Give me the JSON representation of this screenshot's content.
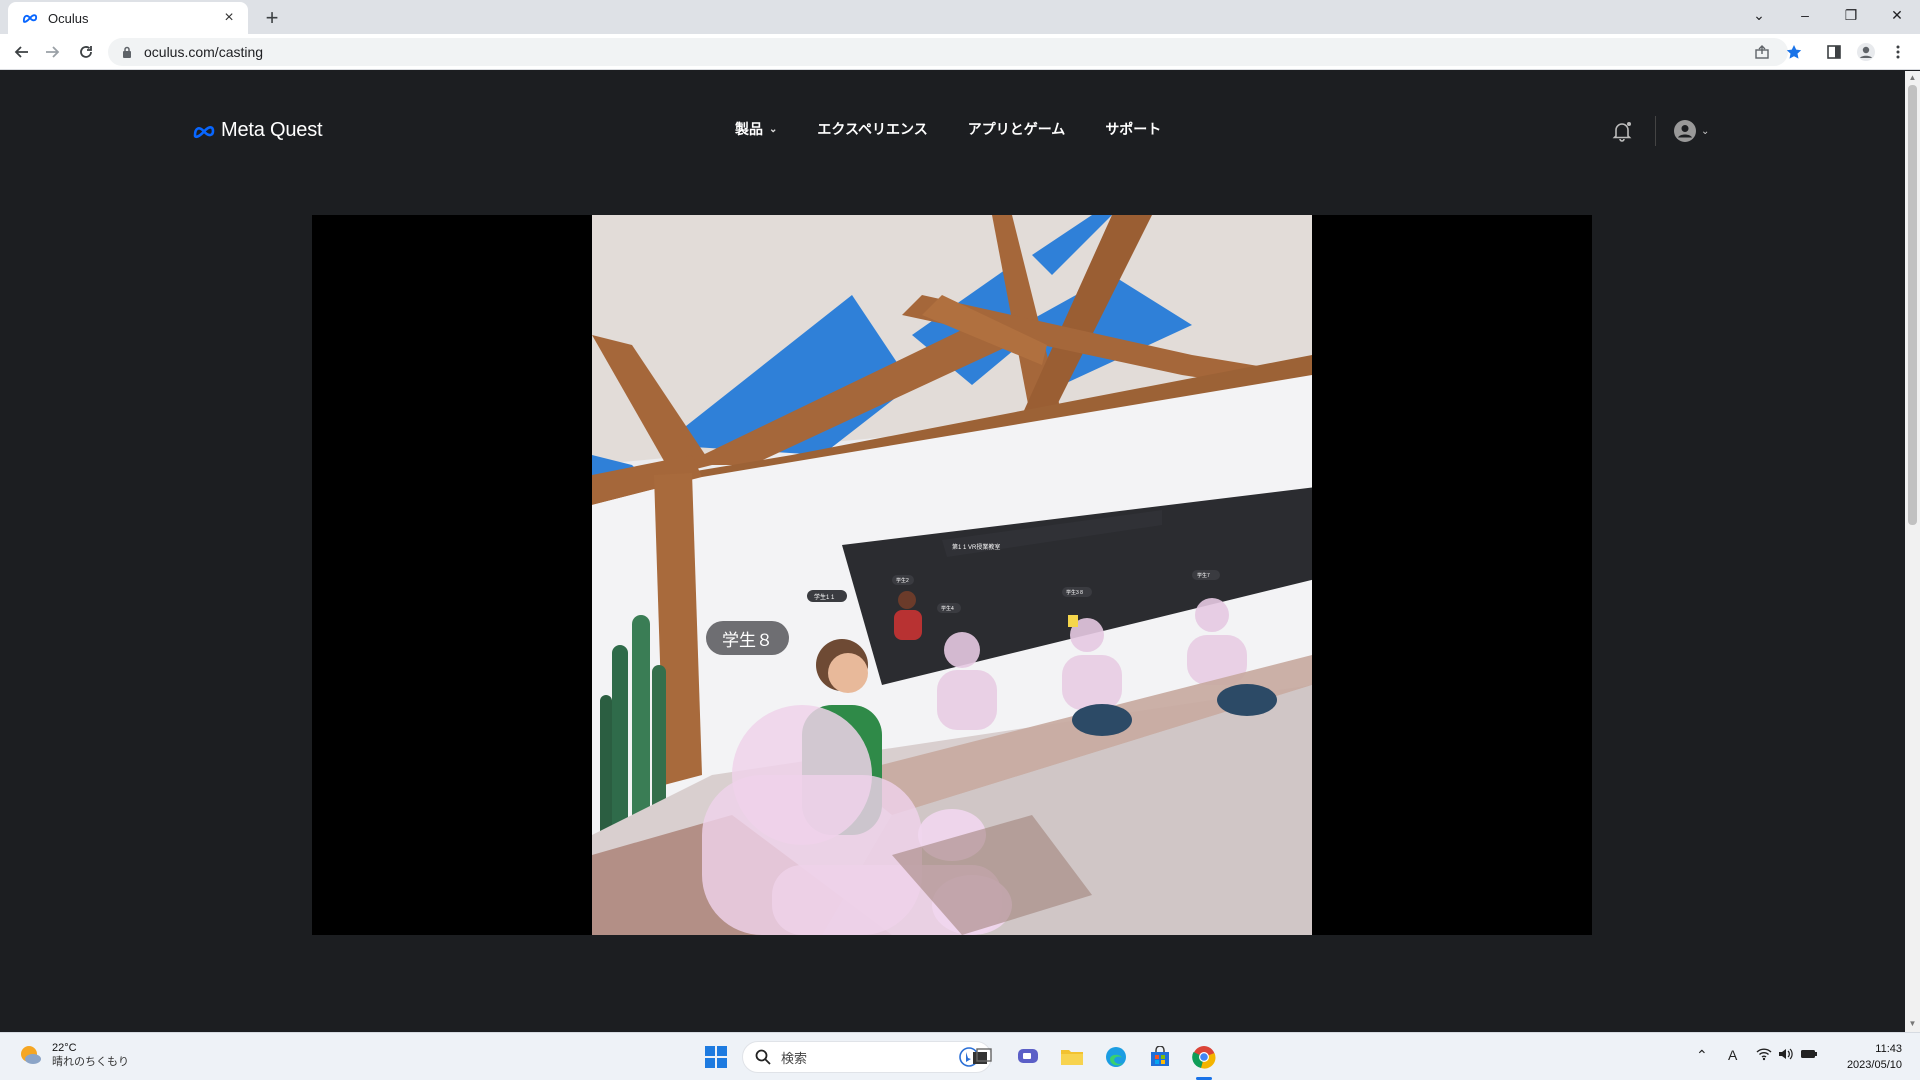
{
  "browser": {
    "tab_title": "Oculus",
    "tab_close": "×",
    "new_tab": "+",
    "url": "oculus.com/casting",
    "window_controls": [
      "⌄",
      "–",
      "❐",
      "✕"
    ]
  },
  "site": {
    "logo_text": "Meta Quest",
    "nav": [
      {
        "label": "製品",
        "has_dropdown": true
      },
      {
        "label": "エクスペリエンス"
      },
      {
        "label": "アプリとゲーム"
      },
      {
        "label": "サポート"
      }
    ],
    "icons": [
      "bell-icon",
      "account-icon",
      "chevron-down-icon"
    ]
  },
  "cast": {
    "name_tag": "学生８",
    "board_title": "第1 1 VR授業教室",
    "board_labels": [
      "学生1 1",
      "学生2",
      "学生4",
      "学生3 8",
      "学生7"
    ]
  },
  "taskbar": {
    "weather_temp": "22°C",
    "weather_desc": "晴れのちくもり",
    "search_label": "検索",
    "time": "11:43",
    "date": "2023/05/10",
    "ime": "A"
  },
  "colors": {
    "page_bg": "#1c1e21",
    "meta_blue": "#0866ff",
    "sky_blue": "#2f80d8",
    "wood": "#a5673a"
  }
}
